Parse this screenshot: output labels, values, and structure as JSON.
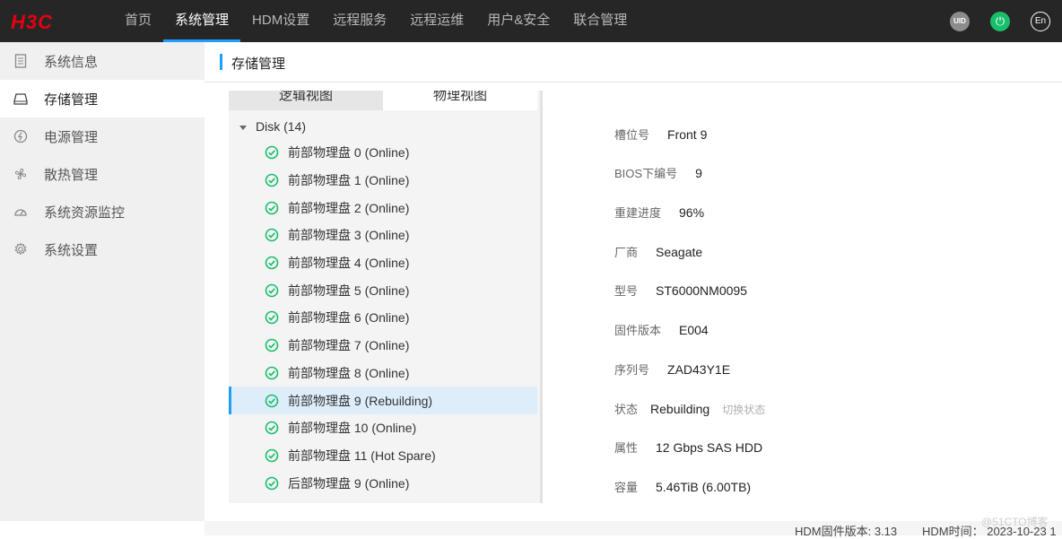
{
  "brand": {
    "logo_text": "H3C",
    "color": "#e60012"
  },
  "nav": {
    "items": [
      "首页",
      "系统管理",
      "HDM设置",
      "远程服务",
      "远程运维",
      "用户&安全",
      "联合管理"
    ],
    "active_index": 1
  },
  "top_icons": {
    "uid": "UID",
    "lang": "En"
  },
  "sidebar": {
    "items": [
      {
        "label": "系统信息",
        "icon": "document-icon"
      },
      {
        "label": "存储管理",
        "icon": "storage-icon"
      },
      {
        "label": "电源管理",
        "icon": "power-source-icon"
      },
      {
        "label": "散热管理",
        "icon": "fan-icon"
      },
      {
        "label": "系统资源监控",
        "icon": "gauge-icon"
      },
      {
        "label": "系统设置",
        "icon": "gear-icon"
      }
    ],
    "active_index": 1
  },
  "page": {
    "title": "存储管理"
  },
  "tabs": {
    "logical": "逻辑视图",
    "physical": "物理视图",
    "active": "physical"
  },
  "tree": {
    "root_label": "Disk (14)",
    "items": [
      "前部物理盘 0 (Online)",
      "前部物理盘 1 (Online)",
      "前部物理盘 2 (Online)",
      "前部物理盘 3 (Online)",
      "前部物理盘 4 (Online)",
      "前部物理盘 5 (Online)",
      "前部物理盘 6 (Online)",
      "前部物理盘 7 (Online)",
      "前部物理盘 8 (Online)",
      "前部物理盘 9 (Rebuilding)",
      "前部物理盘 10 (Online)",
      "前部物理盘 11 (Hot Spare)",
      "后部物理盘 9 (Online)"
    ],
    "selected_index": 9
  },
  "details": {
    "slot": {
      "label": "槽位号",
      "value": "Front 9"
    },
    "bios_no": {
      "label": "BIOS下编号",
      "value": "9"
    },
    "rebuild": {
      "label": "重建进度",
      "value": "96%"
    },
    "vendor": {
      "label": "厂商",
      "value": "Seagate"
    },
    "model": {
      "label": "型号",
      "value": "ST6000NM0095"
    },
    "firmware": {
      "label": "固件版本",
      "value": "E004"
    },
    "serial": {
      "label": "序列号",
      "value": "ZAD43Y1E"
    },
    "status": {
      "label": "状态",
      "value": "Rebuilding",
      "action": "切换状态"
    },
    "attribute": {
      "label": "属性",
      "value": "12 Gbps SAS HDD"
    },
    "capacity": {
      "label": "容量",
      "value": "5.46TiB (6.00TB)"
    }
  },
  "footer": {
    "fw_label": "HDM固件版本: 3.13",
    "time_label": "HDM时间： 2023-10-23 1"
  },
  "watermark": "@51CTO博客",
  "colors": {
    "accent": "#1e9fff",
    "online_green": "#19be6b",
    "topbar": "#262626"
  }
}
